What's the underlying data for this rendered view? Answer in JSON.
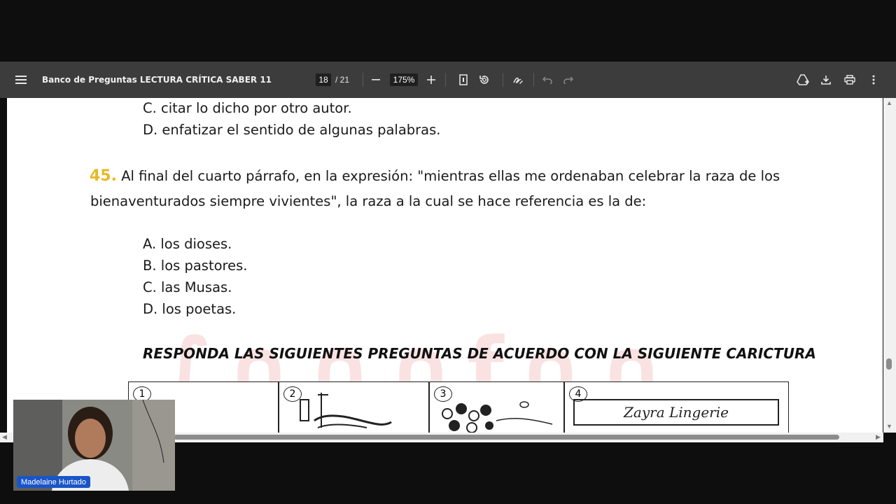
{
  "toolbar": {
    "title": "Banco de Preguntas LECTURA CRÍTICA SABER 11",
    "page_current": "18",
    "page_total": "/ 21",
    "zoom": "175%",
    "icons": [
      "menu-icon",
      "zoom-out-icon",
      "zoom-in-icon",
      "fit-page-icon",
      "rotate-icon",
      "annotate-icon",
      "undo-icon",
      "redo-icon",
      "drive-icon",
      "download-icon",
      "print-icon",
      "more-icon"
    ]
  },
  "document": {
    "lines": [
      "C. citar lo dicho por otro autor.",
      "D. enfatizar el sentido de algunas palabras."
    ],
    "question": {
      "number": "45.",
      "text_line1": "Al final del cuarto párrafo, en la expresión: \"mientras ellas me ordenaban celebrar la raza de los",
      "text_line2": "bienaventurados siempre vivientes\", la raza a la cual se hace referencia es la de:",
      "options": [
        "A. los dioses.",
        "B. los pastores.",
        "C. las Musas.",
        "D. los poetas."
      ]
    },
    "section_heading": "RESPONDA LAS SIGUIENTES PREGUNTAS DE ACUERDO CON LA SIGUIENTE CARICTURA",
    "cartoon": {
      "panels": [
        "1",
        "2",
        "3",
        "4"
      ],
      "sign_text": "Zayra Lingerie"
    }
  },
  "participant": {
    "name": "Madelaine Hurtado"
  },
  "colors": {
    "toolbar_bg": "#3c3c3c",
    "question_number": "#e8b923",
    "name_tag": "#1a55c8"
  }
}
